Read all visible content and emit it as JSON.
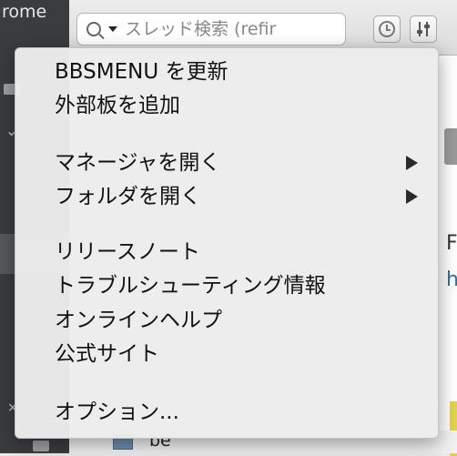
{
  "sidebar": {
    "title": "rome"
  },
  "search": {
    "placeholder": "スレッド検索 (refir"
  },
  "toolbar": {
    "history_icon": "clock-icon",
    "filter_icon": "sliders-icon"
  },
  "content": {
    "peek_letter_1": "F",
    "peek_letter_2": "h",
    "row_label": "be"
  },
  "menu": {
    "items": [
      {
        "label": "BBSMENU を更新"
      },
      {
        "label": "外部板を追加"
      },
      {
        "label": "マネージャを開く",
        "submenu": true
      },
      {
        "label": "フォルダを開く",
        "submenu": true
      },
      {
        "label": "リリースノート"
      },
      {
        "label": "トラブルシューティング情報"
      },
      {
        "label": "オンラインヘルプ"
      },
      {
        "label": "公式サイト"
      },
      {
        "label": "オプション..."
      }
    ]
  },
  "colors": {
    "sidebar_bg": "#3a3d40",
    "menu_bg": "#ececec",
    "link": "#2a6fb0",
    "highlight_yellow": "#e6d24a"
  }
}
